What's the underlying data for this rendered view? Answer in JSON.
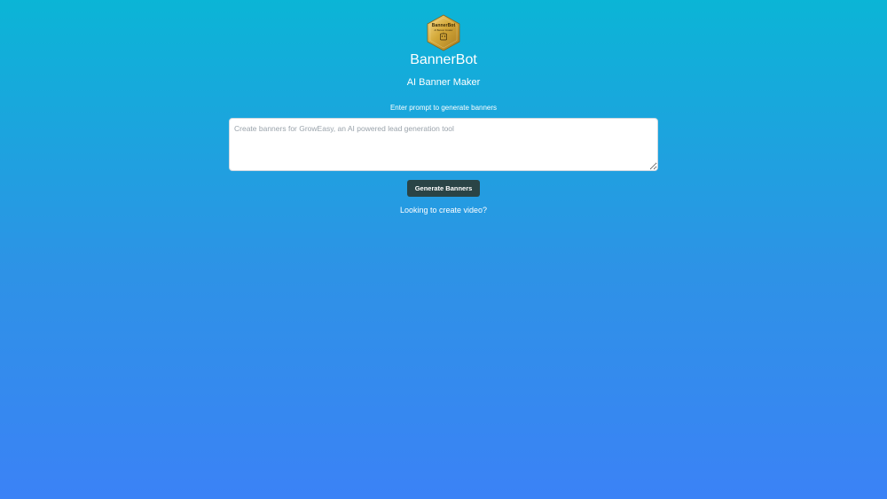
{
  "app": {
    "title": "BannerBot",
    "subtitle": "AI Banner Maker"
  },
  "logo": {
    "icon": "bannerbot-hexagon-badge-icon",
    "text": "BannerBot",
    "tagline": "AI Banner Creator"
  },
  "prompt": {
    "label": "Enter prompt to generate banners",
    "value": "",
    "placeholder": "Create banners for GrowEasy, an AI powered lead generation tool"
  },
  "actions": {
    "generate_label": "Generate Banners",
    "video_link": "Looking to create video?"
  },
  "colors": {
    "background_top": "#0bb5d6",
    "background_bottom": "#3b82f6",
    "button": "#2a4446",
    "logo_gold": "#d4a93a"
  }
}
